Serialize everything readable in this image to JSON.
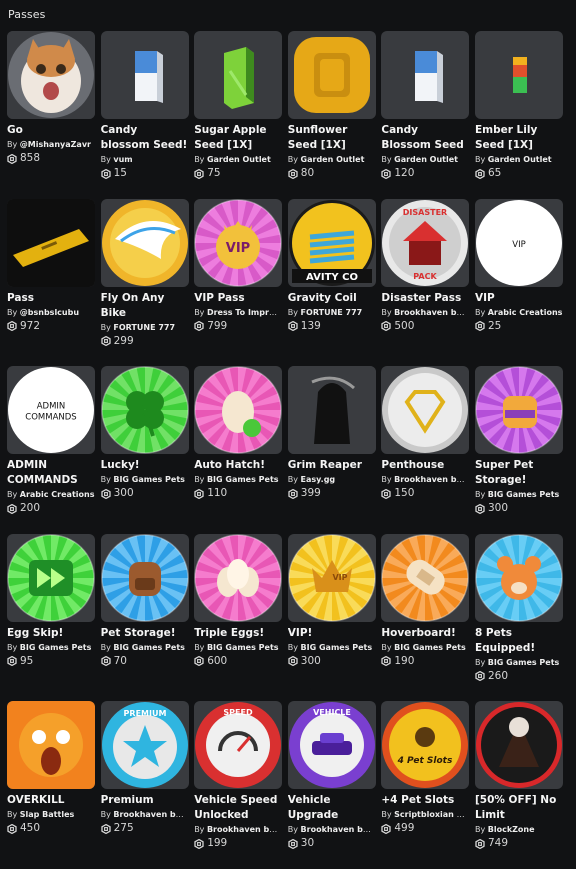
{
  "section": {
    "title": "Passes"
  },
  "creator_prefix": "By ",
  "passes": [
    {
      "name": "Go",
      "creator": "@MishanyaZavr",
      "price": "858",
      "icon": "cat-photo-icon",
      "art": "cat",
      "c1": "#cfc3b5",
      "c2": "#8a6b52"
    },
    {
      "name": "Candy blossom Seed!",
      "creator": "vum",
      "price": "15",
      "icon": "seed-pack-icon",
      "art": "box",
      "c1": "#4a8bd8",
      "c2": "#f2f4f8"
    },
    {
      "name": "Sugar Apple Seed [1X]",
      "creator": "Garden Outlet",
      "price": "75",
      "icon": "green-block-icon",
      "art": "block",
      "c1": "#7ed23a",
      "c2": "#3e8a1e"
    },
    {
      "name": "Sunflower Seed [1X]",
      "creator": "Garden Outlet",
      "price": "80",
      "icon": "yellow-cylinder-icon",
      "art": "cyl",
      "c1": "#e6a817",
      "c2": "#b57d0c"
    },
    {
      "name": "Candy Blossom Seed [1X]",
      "creator": "Garden Outlet",
      "price": "120",
      "icon": "seed-pack-icon",
      "art": "box",
      "c1": "#4a8bd8",
      "c2": "#f2f4f8"
    },
    {
      "name": "Ember Lily Seed [1X]",
      "creator": "Garden Outlet",
      "price": "65",
      "icon": "ember-seed-icon",
      "art": "ember",
      "c1": "#e0502b",
      "c2": "#3bbf52"
    },
    {
      "name": "Pass",
      "creator": "@bsnbslcubu",
      "price": "972",
      "icon": "gold-ticket-icon",
      "art": "ticket",
      "c1": "#e3b10f",
      "c2": "#1a1a1a"
    },
    {
      "name": "Fly On Any Bike",
      "creator": "FORTUNE 777",
      "price": "299",
      "icon": "winged-coin-icon",
      "art": "wing",
      "c1": "#3da3e8",
      "c2": "#f0b52a"
    },
    {
      "name": "VIP Pass",
      "creator": "Dress To Impress ...",
      "price": "799",
      "icon": "vip-crown-icon",
      "art": "vip",
      "c1": "#d85ac8",
      "c2": "#f2c13b"
    },
    {
      "name": "Gravity Coil",
      "creator": "FORTUNE 777",
      "price": "139",
      "icon": "coil-icon",
      "art": "coil",
      "c1": "#f2c21e",
      "c2": "#3ea7d9"
    },
    {
      "name": "Disaster Pass",
      "creator": "Brookhaven by V...",
      "price": "500",
      "icon": "disaster-house-icon",
      "art": "disaster",
      "c1": "#d93030",
      "c2": "#f0f0f0"
    },
    {
      "name": "VIP",
      "creator": "Arabic Creations",
      "price": "25",
      "icon": "vip-text-icon",
      "art": "textcircle",
      "c1": "#ffffff",
      "c2": "#111111",
      "label": "VIP"
    },
    {
      "name": "ADMIN COMMANDS",
      "creator": "Arabic Creations",
      "price": "200",
      "icon": "admin-text-icon",
      "art": "textcircle",
      "c1": "#ffffff",
      "c2": "#111111",
      "label": "ADMIN COMMANDS"
    },
    {
      "name": "Lucky!",
      "creator": "BIG Games Pets",
      "price": "300",
      "icon": "clover-icon",
      "art": "clover",
      "c1": "#3fcf3a",
      "c2": "#1e8a1e"
    },
    {
      "name": "Auto Hatch!",
      "creator": "BIG Games Pets",
      "price": "110",
      "icon": "egg-icon",
      "art": "egg",
      "c1": "#e857b5",
      "c2": "#f5e7d0"
    },
    {
      "name": "Grim Reaper",
      "creator": "Easy.gg",
      "price": "399",
      "icon": "reaper-icon",
      "art": "reaper",
      "c1": "#3a3c40",
      "c2": "#111111"
    },
    {
      "name": "Penthouse",
      "creator": "Brookhaven by V...",
      "price": "150",
      "icon": "diamond-icon",
      "art": "diamond",
      "c1": "#c9c9c9",
      "c2": "#e0b21a"
    },
    {
      "name": "Super Pet Storage!",
      "creator": "BIG Games Pets",
      "price": "300",
      "icon": "backpack-icon",
      "art": "bag",
      "c1": "#b44fd8",
      "c2": "#f2a93b"
    },
    {
      "name": "Egg Skip!",
      "creator": "BIG Games Pets",
      "price": "95",
      "icon": "fast-forward-icon",
      "art": "skip",
      "c1": "#3fd13a",
      "c2": "#1f8f27"
    },
    {
      "name": "Pet Storage!",
      "creator": "BIG Games Pets",
      "price": "70",
      "icon": "backpack-icon",
      "art": "bag2",
      "c1": "#2e9fe6",
      "c2": "#9b5a2e"
    },
    {
      "name": "Triple Eggs!",
      "creator": "BIG Games Pets",
      "price": "600",
      "icon": "eggs-icon",
      "art": "eggs",
      "c1": "#e857b5",
      "c2": "#f5e7d0"
    },
    {
      "name": "VIP!",
      "creator": "BIG Games Pets",
      "price": "300",
      "icon": "vip-crown-icon",
      "art": "vipcrown",
      "c1": "#f2c11e",
      "c2": "#d9901a"
    },
    {
      "name": "Hoverboard!",
      "creator": "BIG Games Pets",
      "price": "190",
      "icon": "hoverboard-icon",
      "art": "hover",
      "c1": "#f28a1e",
      "c2": "#f5e2c4"
    },
    {
      "name": "8 Pets Equipped!",
      "creator": "BIG Games Pets",
      "price": "260",
      "icon": "pet-dog-icon",
      "art": "dog",
      "c1": "#3fb8e8",
      "c2": "#f08a3a"
    },
    {
      "name": "OVERKILL",
      "creator": "Slap Battles",
      "price": "450",
      "icon": "screaming-face-icon",
      "art": "scream",
      "c1": "#f2821e",
      "c2": "#8a2a10"
    },
    {
      "name": "Premium",
      "creator": "Brookhaven by V...",
      "price": "275",
      "icon": "star-icon",
      "art": "star",
      "c1": "#2fb5e0",
      "c2": "#e8e8e8",
      "label": "PREMIUM"
    },
    {
      "name": "Vehicle Speed Unlocked",
      "creator": "Brookhaven by V...",
      "price": "199",
      "icon": "speedometer-icon",
      "art": "speed",
      "c1": "#d93030",
      "c2": "#f0f0f0",
      "label": "SPEED"
    },
    {
      "name": "Vehicle Upgrade",
      "creator": "Brookhaven by V...",
      "price": "30",
      "icon": "car-icon",
      "art": "car",
      "c1": "#7a3fd0",
      "c2": "#f0f0f0",
      "label": "VEHICLE"
    },
    {
      "name": "+4 Pet Slots",
      "creator": "Scriptbloxian Stu...",
      "price": "499",
      "icon": "skull-fire-icon",
      "art": "fire",
      "c1": "#f2c11e",
      "c2": "#e0501e",
      "label": "4 Pet Slots"
    },
    {
      "name": "[50% OFF] No Limit",
      "creator": "BlockZone",
      "price": "749",
      "icon": "volcano-icon",
      "art": "volcano",
      "c1": "#d8282a",
      "c2": "#3a2218"
    }
  ]
}
